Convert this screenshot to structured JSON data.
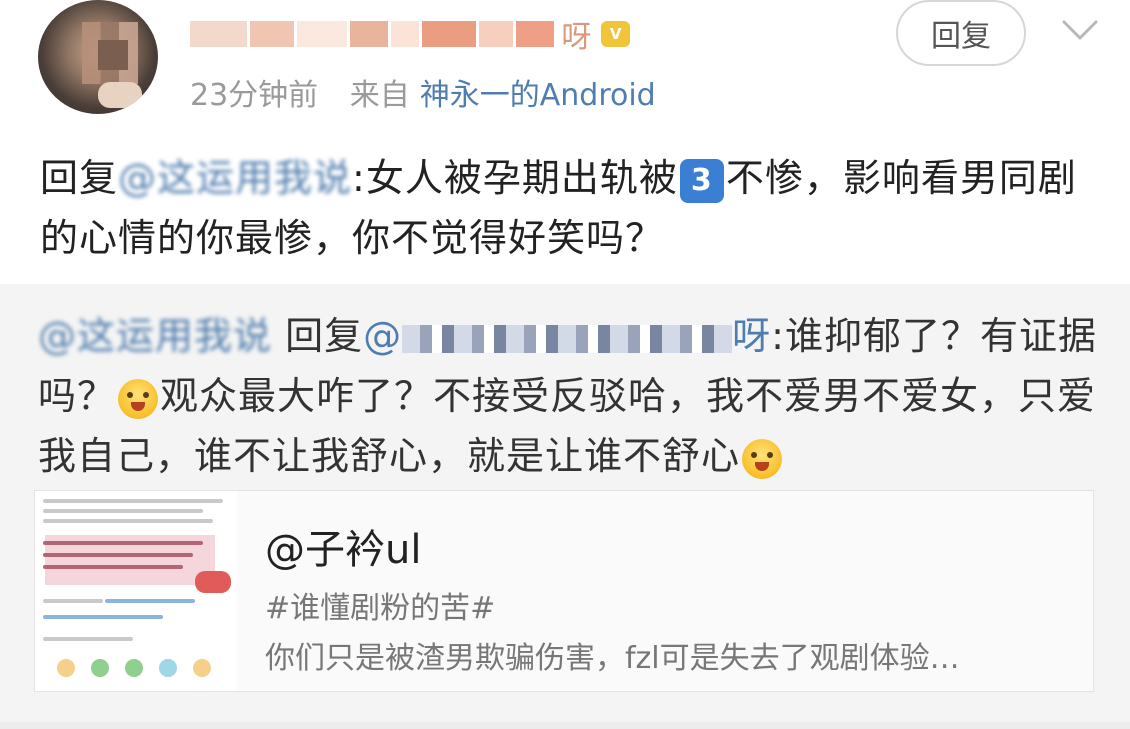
{
  "post": {
    "username_visible": "呀",
    "time": "23分钟前",
    "source_prefix": "来自",
    "source": "神永一的Android",
    "reply_button": "回复",
    "reply_prefix": "回复",
    "mention": "@这运用我说",
    "text_before_badge": ":女人被孕期出轨被",
    "badge_number": "3",
    "text_after_badge": "不惨，影响看男同剧的心情的你最惨，你不觉得好笑吗？"
  },
  "quoted": {
    "mention": "@这运用我说",
    "reply_word": "回复",
    "mention2_prefix": "@",
    "mention2_suffix": "呀",
    "text_1": ":谁抑郁了？有证据吗？",
    "text_2": "观众最大咋了？不接受反驳哈，我不爱男不爱女，只爱我自己，谁不让我舒心，就是让谁不舒心"
  },
  "card": {
    "title": "@子衿ul",
    "topic": "#谁懂剧粉的苦#",
    "description": "你们只是被渣男欺骗伤害，fzl可是失去了观剧体验…"
  },
  "icons": {
    "chevron": "chevron-down-icon",
    "emoji": "grinning-sweat-emoji-icon"
  },
  "colors": {
    "link": "#507daf",
    "badge": "#3b7fd4"
  }
}
